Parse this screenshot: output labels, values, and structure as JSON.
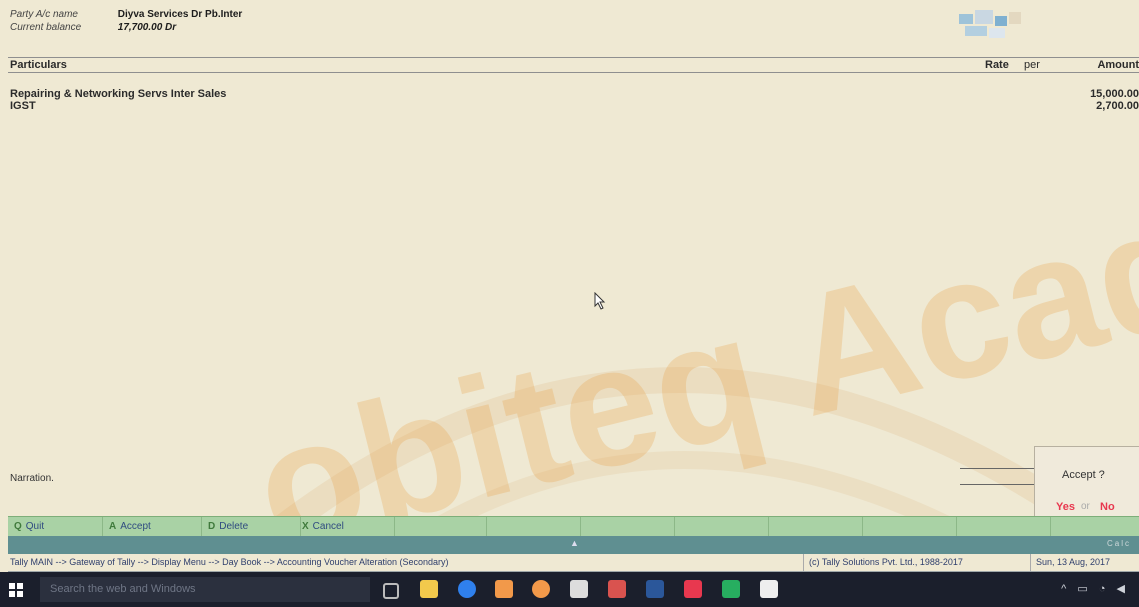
{
  "party": {
    "name_label": "Party A/c name",
    "name_value": "Diyva Services Dr Pb.Inter",
    "balance_label": "Current balance",
    "balance_value": "17,700.00 Dr"
  },
  "table": {
    "col_particulars": "Particulars",
    "col_rate": "Rate",
    "col_per": "per",
    "col_amount": "Amount",
    "rows": [
      {
        "name": "Repairing & Networking Servs Inter Sales",
        "amount": "15,000.00"
      },
      {
        "name": "IGST",
        "amount": "2,700.00"
      }
    ]
  },
  "narration_label": "Narration.",
  "accept": {
    "question": "Accept ?",
    "yes": "Yes",
    "or": "or",
    "no": "No"
  },
  "buttons": [
    {
      "key": "Q",
      "label": "Quit"
    },
    {
      "key": "A",
      "label": "Accept"
    },
    {
      "key": "D",
      "label": "Delete"
    },
    {
      "key": "X",
      "label": "Cancel"
    }
  ],
  "status": {
    "path": "Tally MAIN --> Gateway of Tally --> Display Menu --> Day Book --> Accounting Voucher Alteration  (Secondary)",
    "copyright": "(c) Tally Solutions Pvt. Ltd., 1988-2017",
    "date": "Sun, 13 Aug, 2017"
  },
  "calc_label": "Calc",
  "taskbar": {
    "search_placeholder": "Search the web and Windows"
  },
  "watermark_text": "obiteq Acad",
  "colors": {
    "background": "#efe9d3",
    "button_bar": "#a9d2a5",
    "accent_red": "#e8384f",
    "watermark": "#e8a24a"
  }
}
